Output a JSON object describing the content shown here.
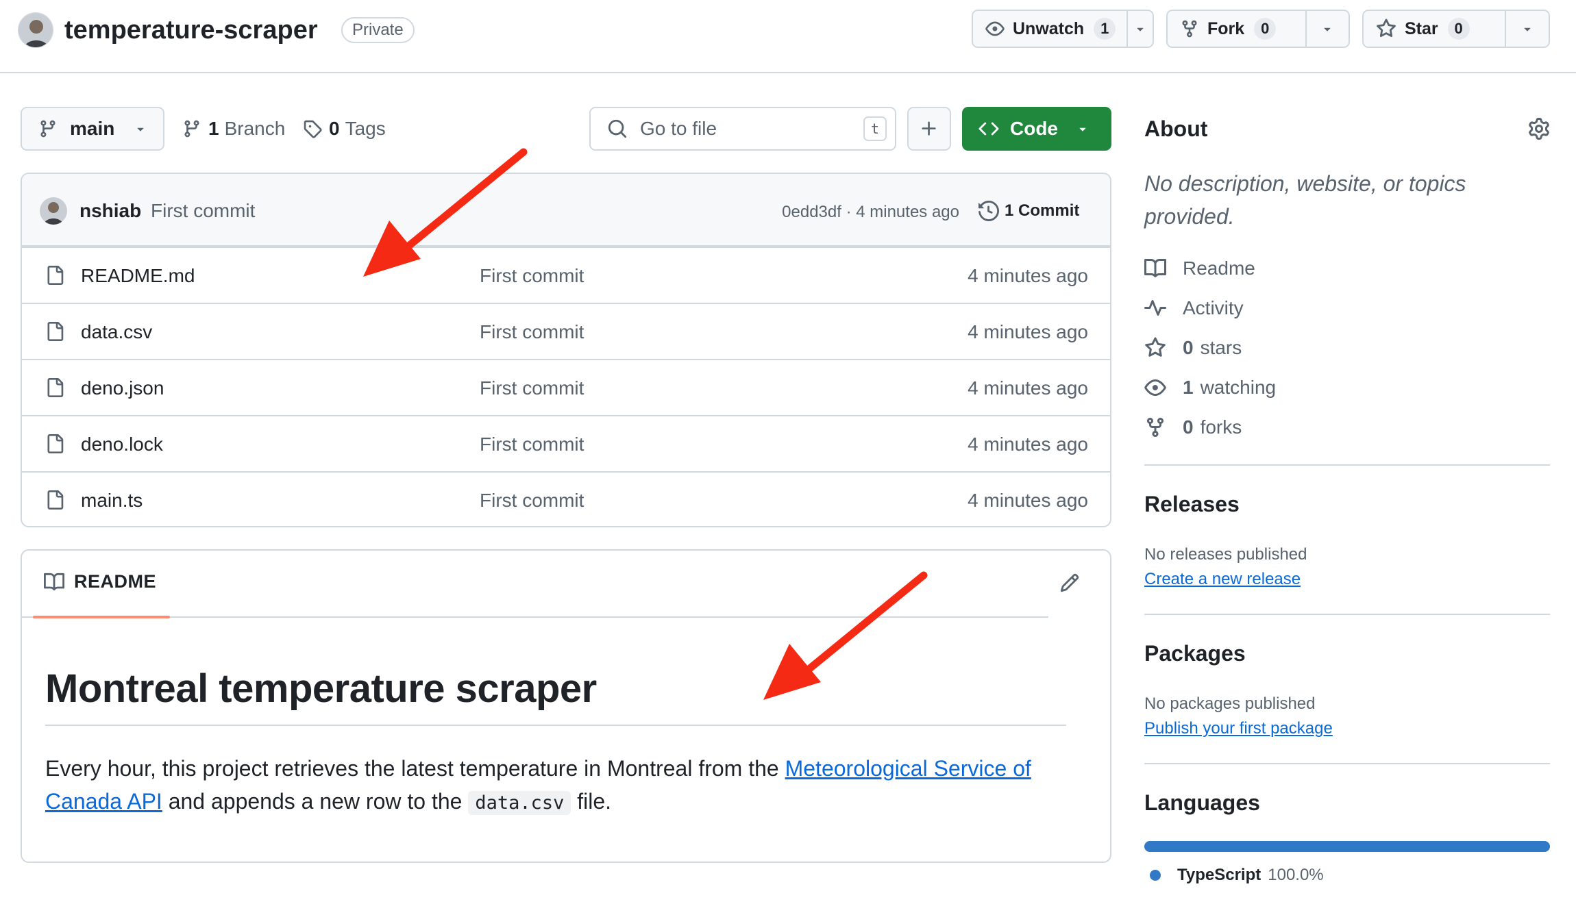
{
  "header": {
    "repo_name": "temperature-scraper",
    "visibility_badge": "Private",
    "unwatch": {
      "label": "Unwatch",
      "count": "1"
    },
    "fork": {
      "label": "Fork",
      "count": "0"
    },
    "star": {
      "label": "Star",
      "count": "0"
    }
  },
  "toolbar": {
    "branch": "main",
    "branches_count": "1",
    "branches_label": "Branch",
    "tags_count": "0",
    "tags_label": "Tags",
    "goto_placeholder": "Go to file",
    "goto_shortcut": "t",
    "code_label": "Code"
  },
  "latest_commit": {
    "author": "nshiab",
    "message": "First commit",
    "sha_time": "0edd3df · 4 minutes ago",
    "commit_count": "1 Commit"
  },
  "files": [
    {
      "name": "README.md",
      "message": "First commit",
      "time": "4 minutes ago"
    },
    {
      "name": "data.csv",
      "message": "First commit",
      "time": "4 minutes ago"
    },
    {
      "name": "deno.json",
      "message": "First commit",
      "time": "4 minutes ago"
    },
    {
      "name": "deno.lock",
      "message": "First commit",
      "time": "4 minutes ago"
    },
    {
      "name": "main.ts",
      "message": "First commit",
      "time": "4 minutes ago"
    }
  ],
  "readme": {
    "tab_label": "README",
    "title": "Montreal temperature scraper",
    "body_before_link": "Every hour, this project retrieves the latest temperature in Montreal from the ",
    "link_text": "Meteorological Service of Canada API",
    "body_middle": " and appends a new row to the ",
    "code_text": "data.csv",
    "body_after": " file."
  },
  "sidebar": {
    "about_title": "About",
    "about_desc": "No description, website, or topics provided.",
    "readme_label": "Readme",
    "activity_label": "Activity",
    "stars_count": "0",
    "stars_label": "stars",
    "watching_count": "1",
    "watching_label": "watching",
    "forks_count": "0",
    "forks_label": "forks",
    "releases_title": "Releases",
    "releases_empty": "No releases published",
    "releases_link": "Create a new release",
    "packages_title": "Packages",
    "packages_empty": "No packages published",
    "packages_link": "Publish your first package",
    "languages_title": "Languages",
    "language_name": "TypeScript",
    "language_pct": "100.0%",
    "language_color": "#3178c6"
  },
  "colors": {
    "primary_button": "#1f883d",
    "link": "#0969da",
    "annotation_arrow": "#f52a14",
    "readme_tab_underline": "#fd8c73"
  }
}
